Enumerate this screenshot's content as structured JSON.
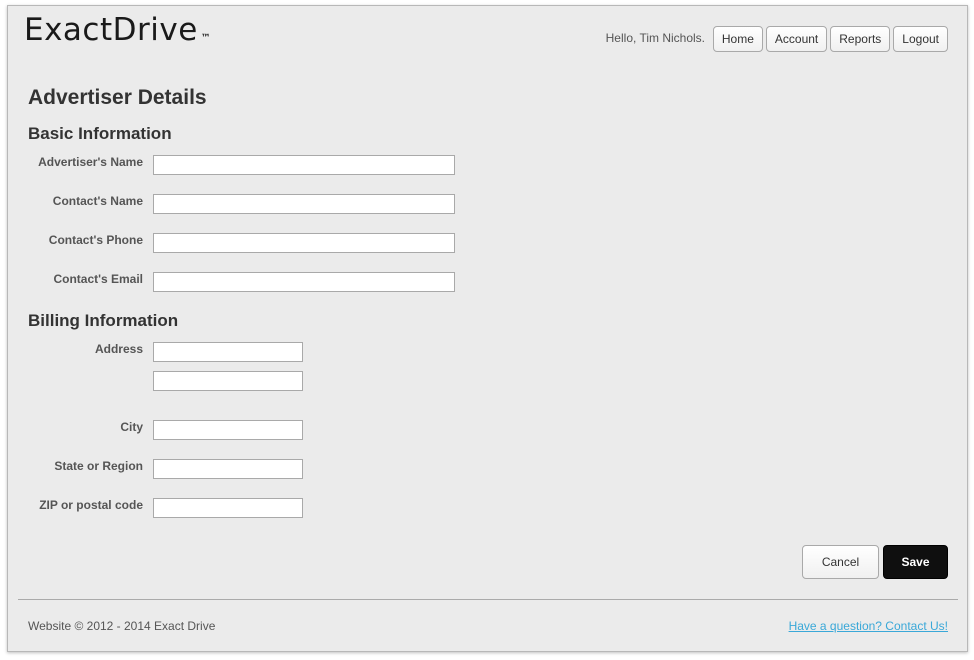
{
  "header": {
    "logo_text": "ExactDrive",
    "logo_mark": "™",
    "greeting": "Hello, Tim Nichols.",
    "nav": [
      "Home",
      "Account",
      "Reports",
      "Logout"
    ]
  },
  "page_title": "Advertiser Details",
  "basic": {
    "heading": "Basic Information",
    "advertiser_name_label": "Advertiser's Name",
    "contact_name_label": "Contact's Name",
    "contact_phone_label": "Contact's Phone",
    "contact_email_label": "Contact's Email",
    "advertiser_name_value": "",
    "contact_name_value": "",
    "contact_phone_value": "",
    "contact_email_value": ""
  },
  "billing": {
    "heading": "Billing Information",
    "address_label": "Address",
    "city_label": "City",
    "state_label": "State or Region",
    "zip_label": "ZIP or postal code",
    "address1_value": "",
    "address2_value": "",
    "city_value": "",
    "state_value": "",
    "zip_value": ""
  },
  "actions": {
    "cancel": "Cancel",
    "save": "Save"
  },
  "footer": {
    "copyright": "Website © 2012 - 2014 Exact Drive",
    "contact_link": "Have a question? Contact Us!"
  },
  "colors": {
    "background": "#ebebeb",
    "save_button": "#0f0f0f",
    "link": "#3aa8d8"
  }
}
